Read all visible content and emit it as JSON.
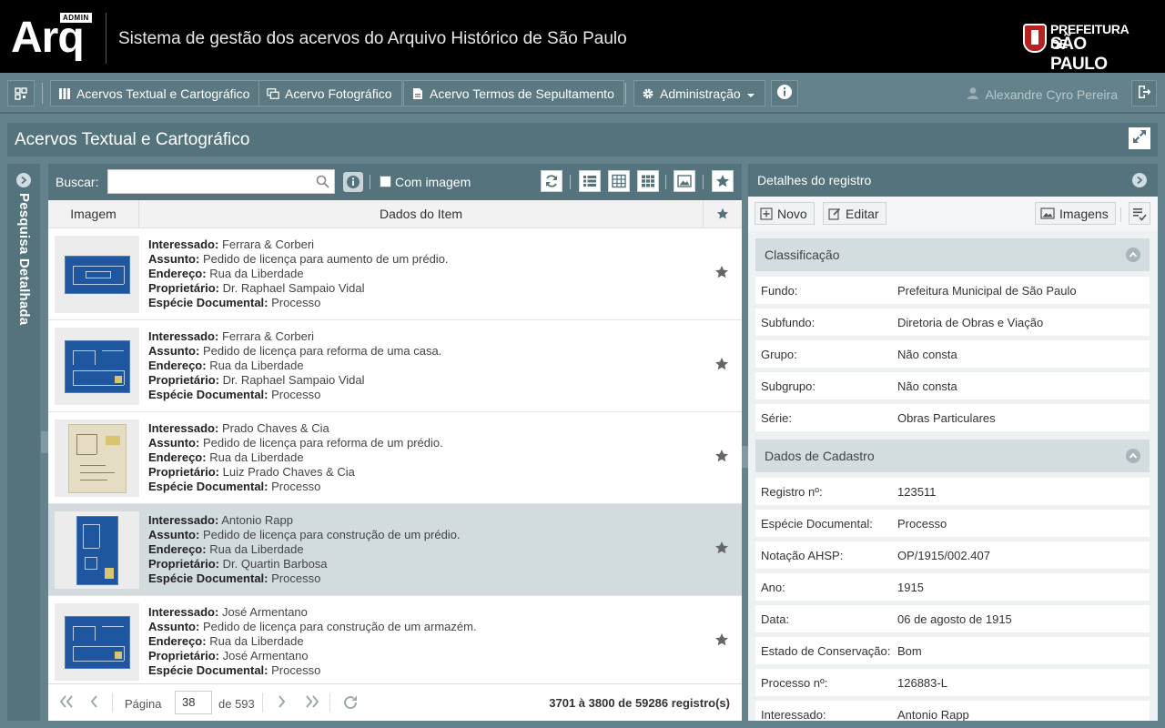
{
  "header": {
    "logo_badge": "ADMIN",
    "logo_text": "Arq",
    "system_title": "Sistema de gestão dos acervos do Arquivo Histórico de São Paulo",
    "prefeitura_line1": "PREFEITURA DE",
    "prefeitura_line2": "SÃO PAULO"
  },
  "toolbar": {
    "items": [
      {
        "label": "Acervos Textual e Cartográfico",
        "icon": "columns-icon"
      },
      {
        "label": "Acervo Fotográfico",
        "icon": "photos-icon"
      },
      {
        "label": "Acervo Termos de Sepultamento",
        "icon": "document-icon"
      },
      {
        "label": "Administração",
        "icon": "gear-icon"
      }
    ],
    "user_name": "Alexandre Cyro Pereira"
  },
  "page": {
    "title": "Acervos Textual e Cartográfico",
    "left_panel_label": "Pesquisa Detalhada"
  },
  "search": {
    "label": "Buscar:",
    "value": "",
    "with_image_label": "Com imagem",
    "with_image_checked": false
  },
  "table": {
    "columns": [
      "Imagem",
      "Dados do Item"
    ],
    "field_labels": {
      "interessado": "Interessado:",
      "assunto": "Assunto:",
      "endereco": "Endereço:",
      "proprietario": "Proprietário:",
      "especie": "Espécie Documental:"
    },
    "rows": [
      {
        "interessado": "Ferrara & Corberi",
        "assunto": "Pedido de licença para aumento de um prédio.",
        "endereco": "Rua da Liberdade",
        "proprietario": "Dr. Raphael Sampaio Vidal",
        "especie": "Processo",
        "thumb": "blue-wide",
        "selected": false
      },
      {
        "interessado": "Ferrara & Corberi",
        "assunto": "Pedido de licença para reforma de uma casa.",
        "endereco": "Rua da Liberdade",
        "proprietario": "Dr. Raphael Sampaio Vidal",
        "especie": "Processo",
        "thumb": "blue-square",
        "selected": false
      },
      {
        "interessado": "Prado Chaves & Cia",
        "assunto": "Pedido de licença para reforma de um prédio.",
        "endereco": "Rua da Liberdade",
        "proprietario": "Luiz Prado Chaves & Cia",
        "especie": "Processo",
        "thumb": "beige",
        "selected": false
      },
      {
        "interessado": "Antonio Rapp",
        "assunto": "Pedido de licença para construção de um prédio.",
        "endereco": "Rua da Liberdade",
        "proprietario": "Dr. Quartin Barbosa",
        "especie": "Processo",
        "thumb": "blue-tall",
        "selected": true
      },
      {
        "interessado": "José Armentano",
        "assunto": "Pedido de licença para construção de um armazém.",
        "endereco": "Rua da Liberdade",
        "proprietario": "José Armentano",
        "especie": "Processo",
        "thumb": "blue-square",
        "selected": false
      }
    ]
  },
  "pager": {
    "page_label": "Página",
    "page_value": "38",
    "of_label": "de 593",
    "summary": "3701 à 3800 de 59286 registro(s)"
  },
  "details": {
    "title": "Detalhes do registro",
    "new_label": "Novo",
    "edit_label": "Editar",
    "images_label": "Imagens",
    "classificacao": {
      "title": "Classificação",
      "fields": [
        {
          "k": "Fundo:",
          "v": "Prefeitura Municipal de São Paulo"
        },
        {
          "k": "Subfundo:",
          "v": "Diretoria de Obras e Viação"
        },
        {
          "k": "Grupo:",
          "v": "Não consta"
        },
        {
          "k": "Subgrupo:",
          "v": "Não consta"
        },
        {
          "k": "Série:",
          "v": "Obras Particulares"
        }
      ]
    },
    "cadastro": {
      "title": "Dados de Cadastro",
      "fields": [
        {
          "k": "Registro nº:",
          "v": "123511"
        },
        {
          "k": "Espécie Documental:",
          "v": "Processo"
        },
        {
          "k": "Notação AHSP:",
          "v": "OP/1915/002.407"
        },
        {
          "k": "Ano:",
          "v": "1915"
        },
        {
          "k": "Data:",
          "v": "06 de agosto de 1915"
        },
        {
          "k": "Estado de Conservação:",
          "v": "Bom"
        },
        {
          "k": "Processo nº:",
          "v": "126883-L"
        },
        {
          "k": "Interessado:",
          "v": "Antonio Rapp"
        }
      ]
    }
  },
  "colors": {
    "header_bg": "#000000",
    "app_bg": "#63828b",
    "panel_header": "#54737c",
    "selected_row": "#d2dcde",
    "section_bg": "#d3dcdf"
  }
}
